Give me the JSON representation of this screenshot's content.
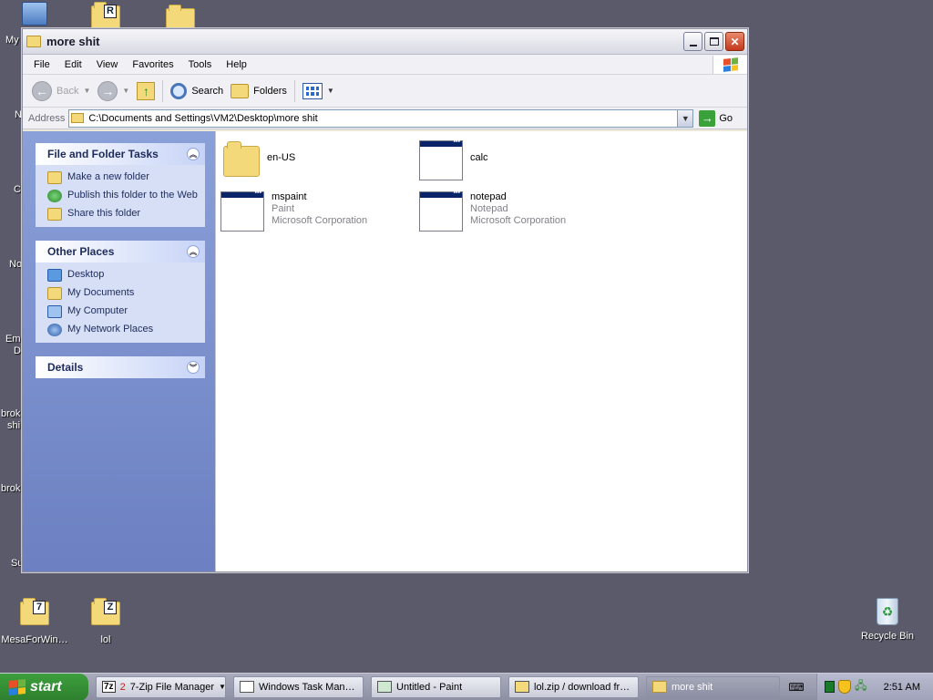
{
  "desktop": {
    "left_icons_partial": [
      "My",
      "N",
      "C",
      "No",
      "Em",
      "D",
      "brok",
      "shi",
      "brok",
      "Su"
    ],
    "bottom_icons": [
      {
        "label": "MesaForWin…",
        "badge": "7"
      },
      {
        "label": "lol",
        "badge": "Z"
      }
    ],
    "top_icons": [
      {
        "badge": "R"
      }
    ],
    "recycle_bin": "Recycle Bin"
  },
  "window": {
    "title": "more shit",
    "menu": [
      "File",
      "Edit",
      "View",
      "Favorites",
      "Tools",
      "Help"
    ],
    "toolbar": {
      "back": "Back",
      "search": "Search",
      "folders": "Folders"
    },
    "address": {
      "label": "Address",
      "path": "C:\\Documents and Settings\\VM2\\Desktop\\more shit",
      "go": "Go"
    },
    "tasks_panel": {
      "title": "File and Folder Tasks",
      "items": [
        "Make a new folder",
        "Publish this folder to the Web",
        "Share this folder"
      ]
    },
    "places_panel": {
      "title": "Other Places",
      "items": [
        "Desktop",
        "My Documents",
        "My Computer",
        "My Network Places"
      ]
    },
    "details_panel": {
      "title": "Details"
    },
    "files": [
      {
        "name": "en-US",
        "kind": "folder"
      },
      {
        "name": "calc",
        "kind": "exe"
      },
      {
        "name": "mspaint",
        "desc": "Paint",
        "company": "Microsoft Corporation",
        "kind": "exe"
      },
      {
        "name": "notepad",
        "desc": "Notepad",
        "company": "Microsoft Corporation",
        "kind": "exe"
      }
    ]
  },
  "taskbar": {
    "start": "start",
    "items": [
      {
        "label": "7-Zip File Manager",
        "prefix": "2"
      },
      {
        "label": "Windows Task Man…"
      },
      {
        "label": "Untitled - Paint"
      },
      {
        "label": "lol.zip / download fr…"
      },
      {
        "label": "more shit",
        "active": true
      }
    ],
    "clock": "2:51 AM"
  },
  "colors": {
    "desktop": "#5a5a6a",
    "taskpane": "#7d91c8",
    "start": "#3c9f3c",
    "titlebar_close": "#c4381a"
  }
}
